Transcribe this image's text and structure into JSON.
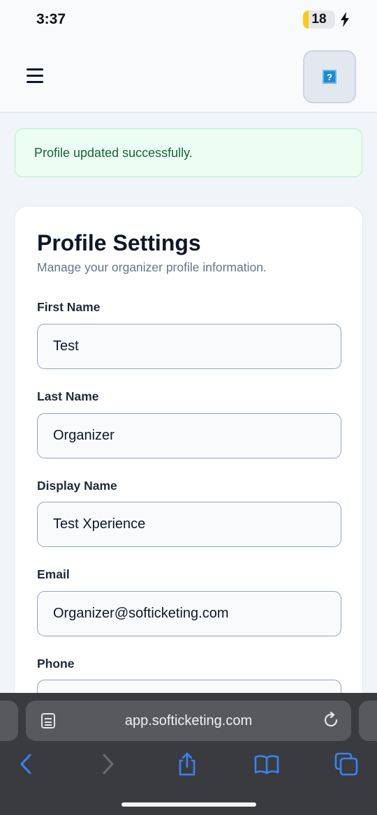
{
  "status_bar": {
    "time": "3:37",
    "battery_level": "18",
    "battery_fraction": 0.18,
    "battery_color": "#facc15"
  },
  "header": {
    "menu_icon": "hamburger-menu-icon",
    "avatar_icon": "broken-image-icon",
    "avatar_glyph": "?"
  },
  "alert": {
    "message": "Profile updated successfully.",
    "color": "#166534",
    "background": "#ecfdf3"
  },
  "profile": {
    "title": "Profile Settings",
    "subtitle": "Manage your organizer profile information.",
    "fields": [
      {
        "label": "First Name",
        "value": "Test"
      },
      {
        "label": "Last Name",
        "value": "Organizer"
      },
      {
        "label": "Display Name",
        "value": "Test Xperience"
      },
      {
        "label": "Email",
        "value": "Organizer@softicketing.com"
      },
      {
        "label": "Phone",
        "value": ""
      }
    ]
  },
  "browser": {
    "url": "app.softicketing.com",
    "icons": [
      "page-menu-icon",
      "reload-icon",
      "back-icon",
      "forward-icon",
      "share-icon",
      "bookmarks-icon",
      "tabs-icon"
    ],
    "accent": "#3b82f6"
  }
}
